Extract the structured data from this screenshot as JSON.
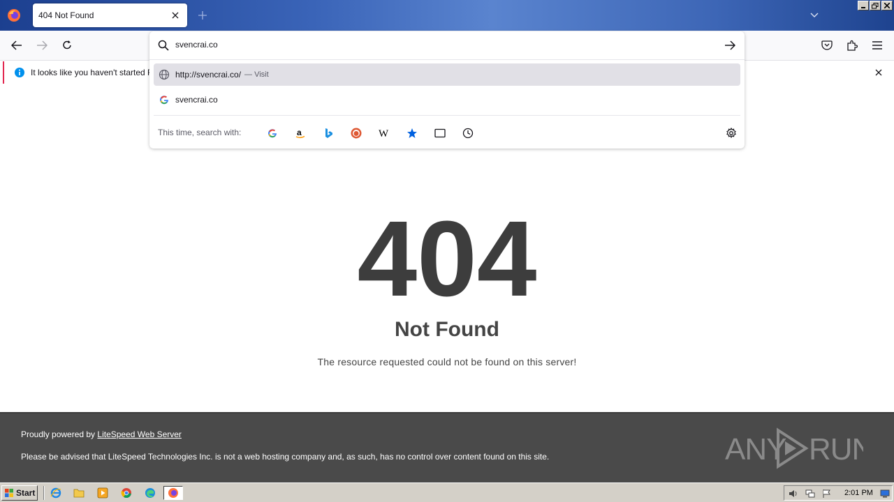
{
  "browser": {
    "tab_title": "404 Not Found"
  },
  "urlbar": {
    "input_value": "svencrai.co",
    "suggestions": [
      {
        "text": "http://svencrai.co/",
        "sub": "— Visit",
        "icon": "globe-icon"
      },
      {
        "text": "svencrai.co",
        "sub": "",
        "icon": "google-icon"
      }
    ],
    "engines_label": "This time, search with:",
    "engines": [
      "google",
      "amazon",
      "bing",
      "duckduckgo",
      "wikipedia",
      "bookmarks",
      "tabs",
      "history"
    ]
  },
  "notification": {
    "text": "It looks like you haven't started Fire"
  },
  "page": {
    "code": "404",
    "heading": "Not Found",
    "message": "The resource requested could not be found on this server!"
  },
  "footer": {
    "powered_prefix": "Proudly powered by ",
    "powered_link": "LiteSpeed Web Server",
    "advisory": "Please be advised that LiteSpeed Technologies Inc. is not a web hosting company and, as such, has no control over content found on this site.",
    "watermark": "ANY RUN"
  },
  "taskbar": {
    "start_label": "Start",
    "clock": "2:01 PM"
  },
  "colors": {
    "accent_notification": "#e22850",
    "footer_bg": "#4a4a4a",
    "selected_suggestion": "#e1e0e6"
  }
}
